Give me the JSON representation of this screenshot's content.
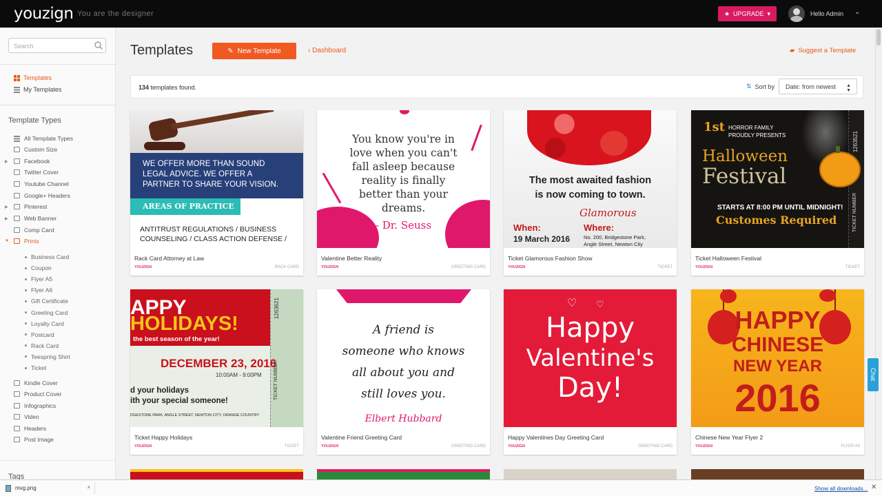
{
  "topbar": {
    "logo": "youzign",
    "tagline": "You are the designer",
    "upgrade_label": "UPGRADE",
    "user_label": "Hello Admin"
  },
  "sidebar": {
    "search_placeholder": "Search",
    "nav": [
      {
        "label": "Templates",
        "active": true
      },
      {
        "label": "My Templates",
        "active": false
      }
    ],
    "template_types_title": "Template Types",
    "types": [
      {
        "label": "All Template Types"
      },
      {
        "label": "Custom Size"
      },
      {
        "label": "Facebook"
      },
      {
        "label": "Twitter Cover"
      },
      {
        "label": "Youtube Channel"
      },
      {
        "label": "Google+ Headers"
      },
      {
        "label": "Pinterest"
      },
      {
        "label": "Web Banner"
      },
      {
        "label": "Comp Card"
      },
      {
        "label": "Prints"
      }
    ],
    "prints_sub": [
      "Business Card",
      "Coupon",
      "Flyer A5",
      "Flyer A6",
      "Gift Certificate",
      "Greeting Card",
      "Loyalty Card",
      "Postcard",
      "Rack Card",
      "Teespring Shirt",
      "Ticket"
    ],
    "types_after": [
      "Kindle Cover",
      "Product Cover",
      "Infographics",
      "Video",
      "Headers",
      "Post Image"
    ],
    "tags_title": "Tags"
  },
  "main": {
    "title": "Templates",
    "new_template_label": "New Template",
    "dashboard_link": "Dashboard",
    "suggest_link": "Suggest a Template",
    "count_number": "134",
    "count_suffix": "templates found.",
    "sort_label": "Sort by",
    "sort_value": "Date: from newest"
  },
  "cards": [
    {
      "name": "Rack Card Attorney at Law",
      "brand": "YOUZIGN",
      "category": "RACK CARD"
    },
    {
      "name": "Valentine Better Reality",
      "brand": "YOUZIGN",
      "category": "GREETING CARD"
    },
    {
      "name": "Ticket Glamorous Fashion Show",
      "brand": "YOUZIGN",
      "category": "TICKET"
    },
    {
      "name": "Ticket Halloween Festival",
      "brand": "YOUZIGN",
      "category": "TICKET"
    },
    {
      "name": "Ticket Happy Holidays",
      "brand": "YOUZIGN",
      "category": "TICKET"
    },
    {
      "name": "Valentine Friend Greeting Card",
      "brand": "YOUZIGN",
      "category": "GREETING CARD"
    },
    {
      "name": "Happy Valentines Day Greeting Card",
      "brand": "YOUZIGN",
      "category": "GREETING CARD"
    },
    {
      "name": "Chinese New Year Flyer 2",
      "brand": "YOUZIGN",
      "category": "FLYER A5"
    }
  ],
  "thumbs": {
    "attorney": {
      "line1": "WE OFFER MORE THAN SOUND",
      "line2": "LEGAL ADVICE. WE OFFER A",
      "line3": "PARTNER TO SHARE YOUR VISION.",
      "practice": "AREAS OF PRACTICE",
      "list1": "ANTITRUST REGULATIONS / BUSINESS",
      "list2": "COUNSELING / CLASS ACTION DEFENSE /"
    },
    "quote": {
      "l1": "You know you're in",
      "l2": "love when you can't",
      "l3": "fall asleep because",
      "l4": "reality is finally",
      "l5": "better than your",
      "l6": "dreams.",
      "author": "- Dr. Seuss"
    },
    "fashion": {
      "l1": "The most awaited fashion",
      "l2": "is now coming to town.",
      "script": "Glamorous",
      "when": "Where:",
      "when2": "When:",
      "date": "19 March 2016",
      "addr1": "No. 200, Bridgestone Park,",
      "addr2": "Angle Street, Newton City"
    },
    "halloween": {
      "first": "1st",
      "fam1": "HORROR FAMILY",
      "fam2": "PROUDLY PRESENTS",
      "h1": "Halloween",
      "h2": "Festival",
      "starts": "STARTS AT 8:00 PM UNTIL MIDNIGHT!",
      "costume": "Customes Required",
      "ticketno": "TICKET NUMBER",
      "num": "1263521"
    },
    "holidays": {
      "h1": "APPY",
      "h2": "HOLIDAYS!",
      "sub": "the best season of the year!",
      "date": "DECEMBER 23, 2016",
      "time": "10:00AM - 9:00PM",
      "p1": "d your holidays",
      "p2": "ith your special someone!",
      "addr": "DGESTONE PARK, ANGLE STREET, NEWTON CITY, ORANGE COUNTRY",
      "ticketno": "TICKET NUMBER",
      "num": "1263621"
    },
    "friend": {
      "l1": "A friend is",
      "l2": "someone who knows",
      "l3": "all about you and",
      "l4": "still loves you.",
      "author": "Elbert Hubbard"
    },
    "valentine": {
      "l1": "Happy",
      "l2": "Valentine's",
      "l3": "Day!"
    },
    "chinese": {
      "l1": "HAPPY",
      "l2": "CHINESE",
      "l3": "NEW YEAR",
      "year": "2016"
    }
  },
  "download_bar": {
    "file": "mvg.png",
    "show_all": "Show all downloads..."
  },
  "colors": {
    "accent": "#f05a22",
    "upgrade": "#d81b60",
    "topbar": "#0b0b0b"
  }
}
